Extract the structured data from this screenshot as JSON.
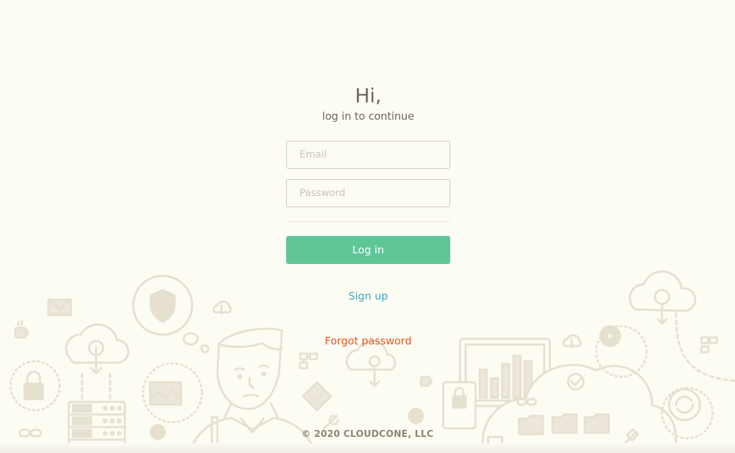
{
  "login": {
    "greeting": "Hi,",
    "subtitle": "log in to continue",
    "email_placeholder": "Email",
    "password_placeholder": "Password",
    "login_label": "Log in",
    "signup_label": "Sign up",
    "forgot_label": "Forgot password"
  },
  "footer": {
    "copyright": "© 2020 CLOUDCONE, LLC"
  },
  "colors": {
    "background": "#fdfcf3",
    "accent_green": "#5fc697",
    "link_blue": "#3aa7c4",
    "link_orange": "#e8571f",
    "illustration": "#e8e3d5"
  },
  "illustration": {
    "icons": [
      "envelope-icon",
      "coffee-cup-icon",
      "cloud-upload-icon",
      "shield-icon",
      "padlock-icon",
      "picture-icon",
      "server-rack-icon",
      "link-icon",
      "person-illustration",
      "cloud-download-icon",
      "flowchart-icon",
      "monitor-chart-icon",
      "folder-icon",
      "checkmark-icon",
      "play-icon",
      "refresh-icon",
      "plug-icon"
    ]
  }
}
